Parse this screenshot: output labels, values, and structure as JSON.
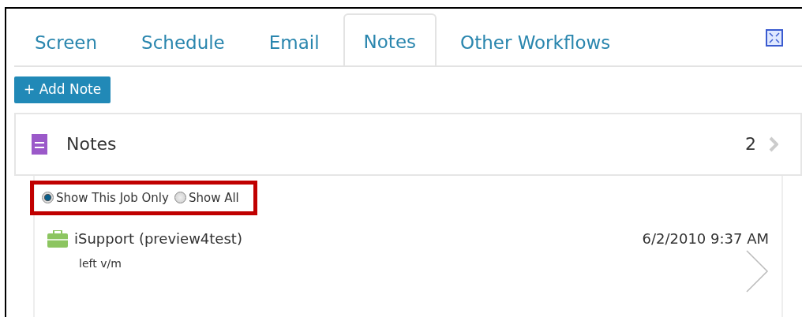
{
  "tabs": [
    {
      "label": "Screen",
      "selected": false
    },
    {
      "label": "Schedule",
      "selected": false
    },
    {
      "label": "Email",
      "selected": false
    },
    {
      "label": "Notes",
      "selected": true
    },
    {
      "label": "Other Workflows",
      "selected": false
    }
  ],
  "add_button": "+ Add Note",
  "panel": {
    "title": "Notes",
    "count": "2"
  },
  "filter": {
    "highlighted": true,
    "options": [
      {
        "label": "Show This Job Only",
        "selected": true
      },
      {
        "label": "Show All",
        "selected": false
      }
    ]
  },
  "notes": [
    {
      "author": "iSupport (preview4test)",
      "text": "left v/m",
      "time": "6/2/2010 9:37 AM"
    }
  ]
}
